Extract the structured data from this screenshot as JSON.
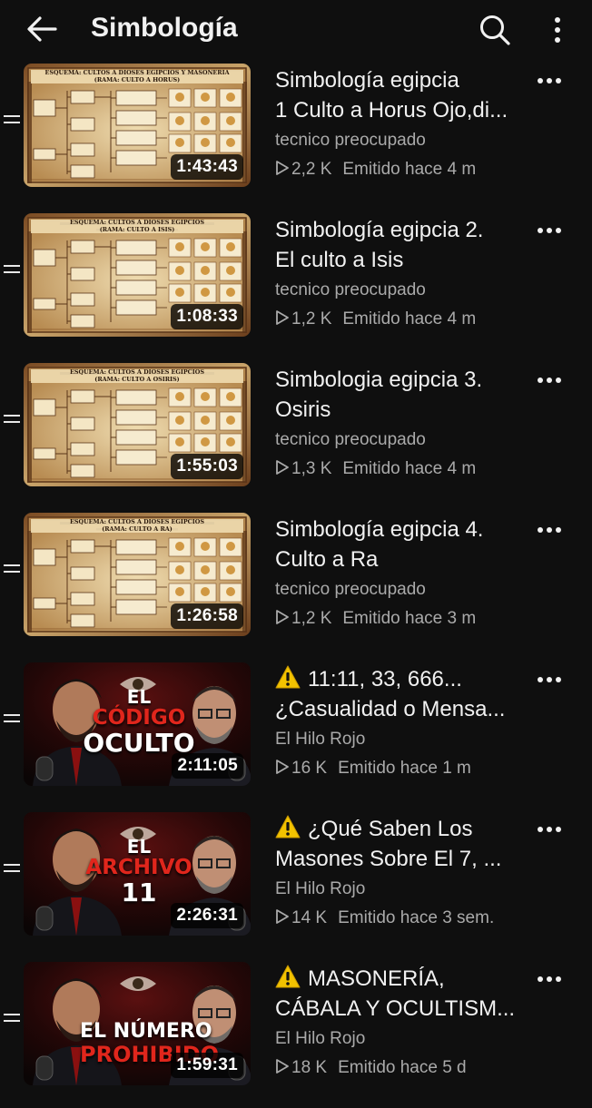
{
  "header": {
    "title": "Simbología",
    "back_icon": "arrow-left-icon",
    "search_icon": "search-icon",
    "menu_icon": "more-vert-icon"
  },
  "colors": {
    "background": "#0f0f0f",
    "text_primary": "#f1f1f1",
    "text_secondary": "#aaaaaa",
    "warning": "#f2c200"
  },
  "videos": [
    {
      "title_lines": [
        "Simbología egipcia",
        "1 Culto a Horus Ojo,di..."
      ],
      "warning": false,
      "channel": "tecnico preocupado",
      "views": "2,2 K",
      "age": "Emitido hace 4 m",
      "duration": "1:43:43",
      "thumb_style": "diagram",
      "thumb_heading": "ESQUEMA: CULTOS A DIOSES EGIPCIOS Y MASONERÍA",
      "thumb_sub": "(RAMA: CULTO A HORUS)"
    },
    {
      "title_lines": [
        "Simbología egipcia  2.",
        "El culto a Isis"
      ],
      "warning": false,
      "channel": "tecnico preocupado",
      "views": "1,2 K",
      "age": "Emitido hace 4 m",
      "duration": "1:08:33",
      "thumb_style": "diagram",
      "thumb_heading": "ESQUEMA: CULTOS A DIOSES EGIPCIOS",
      "thumb_sub": "(RAMA: CULTO A ISIS)"
    },
    {
      "title_lines": [
        "Simbologia egipcia 3.",
        "Osiris"
      ],
      "warning": false,
      "channel": "tecnico preocupado",
      "views": "1,3 K",
      "age": "Emitido hace 4 m",
      "duration": "1:55:03",
      "thumb_style": "diagram",
      "thumb_heading": "ESQUEMA: CULTOS A DIOSES EGIPCIOS",
      "thumb_sub": "(RAMA: CULTO A OSIRIS)"
    },
    {
      "title_lines": [
        "Simbología egipcia  4.",
        "Culto a Ra"
      ],
      "warning": false,
      "channel": "tecnico preocupado",
      "views": "1,2 K",
      "age": "Emitido hace 3 m",
      "duration": "1:26:58",
      "thumb_style": "diagram",
      "thumb_heading": "ESQUEMA: CULTOS A DIOSES EGIPCIOS",
      "thumb_sub": "(RAMA: CULTO A RA)"
    },
    {
      "title_lines": [
        "11:11, 33, 666...",
        "¿Casualidad o Mensa..."
      ],
      "warning": true,
      "channel": "El Hilo Rojo",
      "views": "16 K",
      "age": "Emitido hace 1 m",
      "duration": "2:11:05",
      "thumb_style": "poster",
      "thumb_text_1": "EL",
      "thumb_text_2": "CÓDIGO",
      "thumb_text_3": "OCULTO"
    },
    {
      "title_lines": [
        "¿Qué Saben Los",
        "Masones Sobre El 7, ..."
      ],
      "warning": true,
      "channel": "El Hilo Rojo",
      "views": "14 K",
      "age": "Emitido hace 3 sem.",
      "duration": "2:26:31",
      "thumb_style": "poster",
      "thumb_text_1": "EL",
      "thumb_text_2": "ARCHIVO",
      "thumb_text_3": "11"
    },
    {
      "title_lines": [
        "MASONERÍA,",
        "CÁBALA Y OCULTISM..."
      ],
      "warning": true,
      "channel": "El Hilo Rojo",
      "views": "18 K",
      "age": "Emitido hace 5 d",
      "duration": "1:59:31",
      "thumb_style": "poster",
      "thumb_text_1": "",
      "thumb_text_2": "EL NÚMERO",
      "thumb_text_3": "PROHIBIDO"
    }
  ]
}
